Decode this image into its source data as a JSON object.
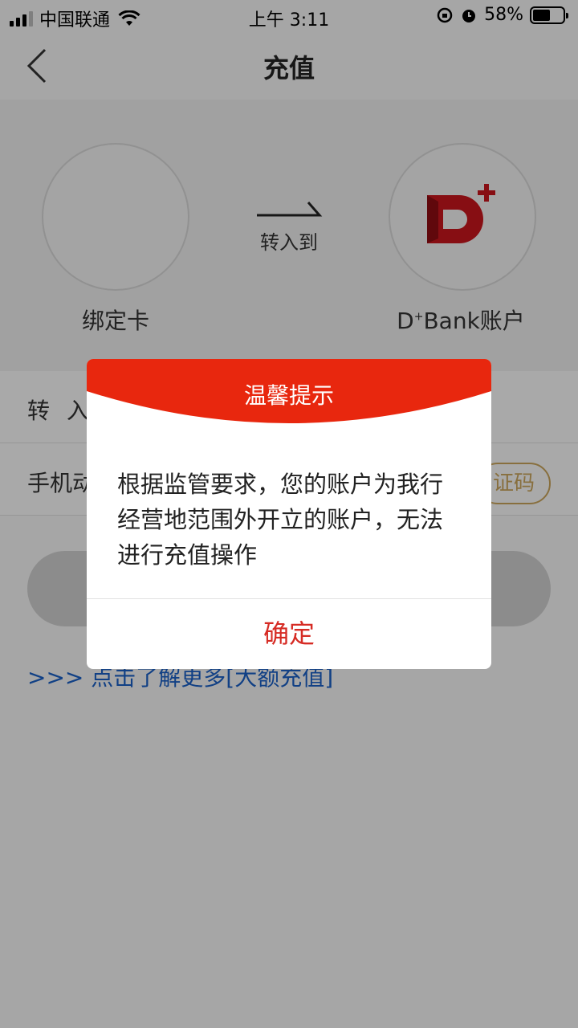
{
  "status_bar": {
    "carrier": "中国联通",
    "time": "上午 3:11",
    "battery": "58%",
    "battery_level": 0.58
  },
  "nav": {
    "title": "充值",
    "back_icon": "chevron-left-icon"
  },
  "transfer": {
    "from_label": "绑定卡",
    "arrow_label": "转入到",
    "to_label_prefix": "D",
    "to_label_sup": "+",
    "to_label_suffix": "Bank账户",
    "brand_color": "#c8161d"
  },
  "form": {
    "amount_label": "转 入",
    "phone_label": "手机动",
    "code_button": "证码"
  },
  "link": {
    "text": ">>> 点击了解更多[大额充值]"
  },
  "dialog": {
    "title": "温馨提示",
    "message": "根据监管要求，您的账户为我行经营地范围外开立的账户，无法进行充值操作",
    "ok_label": "确定",
    "header_color": "#e8270e",
    "ok_color": "#d62b24"
  }
}
